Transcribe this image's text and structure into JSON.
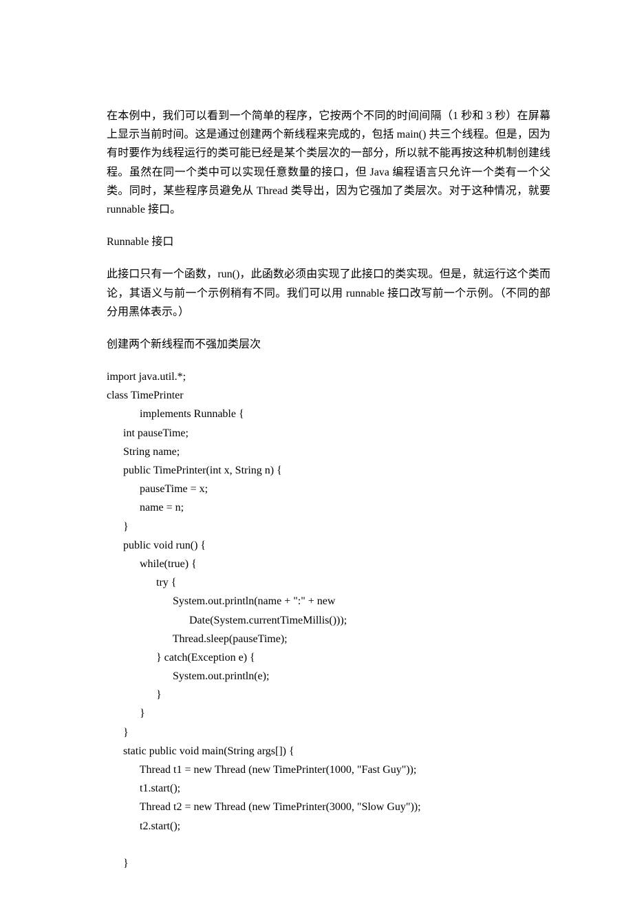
{
  "paragraphs": {
    "p1": "在本例中，我们可以看到一个简单的程序，它按两个不同的时间间隔（1 秒和 3 秒）在屏幕上显示当前时间。这是通过创建两个新线程来完成的，包括 main() 共三个线程。但是，因为有时要作为线程运行的类可能已经是某个类层次的一部分，所以就不能再按这种机制创建线程。虽然在同一个类中可以实现任意数量的接口，但 Java 编程语言只允许一个类有一个父类。同时，某些程序员避免从 Thread 类导出，因为它强加了类层次。对于这种情况，就要 runnable 接口。",
    "p2_title": "Runnable 接口",
    "p3": "此接口只有一个函数，run()，此函数必须由实现了此接口的类实现。但是，就运行这个类而论，其语义与前一个示例稍有不同。我们可以用 runnable 接口改写前一个示例。（不同的部分用黑体表示。）",
    "p4": "创建两个新线程而不强加类层次"
  },
  "code": "import java.util.*;\nclass TimePrinter\n            implements Runnable {\n      int pauseTime;\n      String name;\n      public TimePrinter(int x, String n) {\n            pauseTime = x;\n            name = n;\n      }\n      public void run() {\n            while(true) {\n                  try {\n                        System.out.println(name + \":\" + new\n                              Date(System.currentTimeMillis()));\n                        Thread.sleep(pauseTime);\n                  } catch(Exception e) {\n                        System.out.println(e);\n                  }\n            }\n      }\n      static public void main(String args[]) {\n            Thread t1 = new Thread (new TimePrinter(1000, \"Fast Guy\"));\n            t1.start();\n            Thread t2 = new Thread (new TimePrinter(3000, \"Slow Guy\"));\n            t2.start();\n\n      }"
}
